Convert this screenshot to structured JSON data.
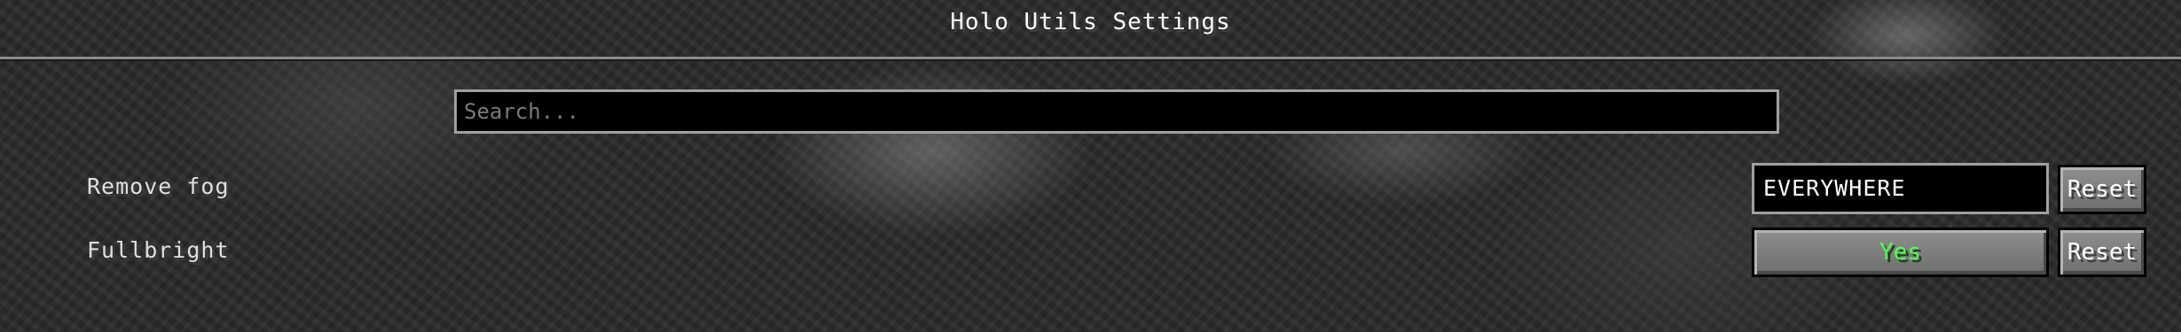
{
  "screen": {
    "title": "Holo Utils Settings"
  },
  "search": {
    "placeholder": "Search...",
    "value": ""
  },
  "options": [
    {
      "label": "Remove fog",
      "value": "EVERYWHERE",
      "reset_label": "Reset"
    },
    {
      "label": "Fullbright",
      "value": "Yes",
      "value_color": "#55ff55",
      "reset_label": "Reset"
    }
  ]
}
